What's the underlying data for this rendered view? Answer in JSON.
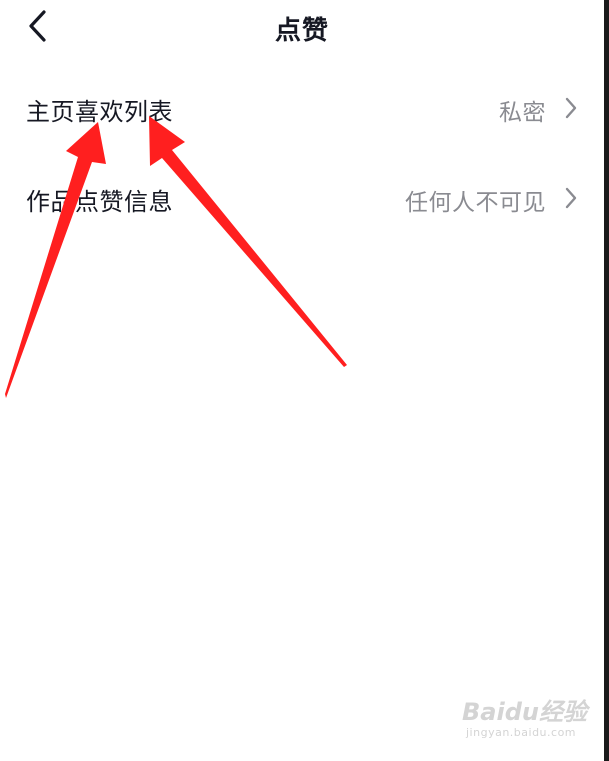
{
  "header": {
    "title": "点赞",
    "back_icon": "chevron-left-icon"
  },
  "settings": {
    "rows": [
      {
        "label": "主页喜欢列表",
        "value": "私密",
        "icon": "chevron-right-icon"
      },
      {
        "label": "作品点赞信息",
        "value": "任何人不可见",
        "icon": "chevron-right-icon"
      }
    ]
  },
  "annotation": {
    "type": "red-arrows",
    "color": "#ff1f1f",
    "count": 2
  },
  "watermark": {
    "brand": "Baidu经验",
    "url": "jingyan.baidu.com",
    "color": "#d4d4d4"
  }
}
